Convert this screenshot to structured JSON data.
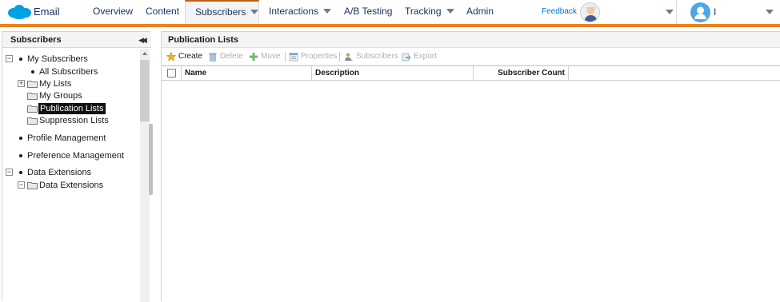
{
  "app": {
    "name": "Email"
  },
  "nav": {
    "items": [
      {
        "label": "Overview"
      },
      {
        "label": "Content"
      },
      {
        "label": "Subscribers"
      },
      {
        "label": "Interactions"
      },
      {
        "label": "A/B Testing"
      },
      {
        "label": "Tracking"
      },
      {
        "label": "Admin"
      }
    ],
    "active": "Subscribers",
    "feedback": "Feedback",
    "user_name": "I"
  },
  "left_panel": {
    "title": "Subscribers",
    "tree": [
      {
        "label": "My Subscribers"
      },
      {
        "label": "All Subscribers"
      },
      {
        "label": "My Lists"
      },
      {
        "label": "My Groups"
      },
      {
        "label": "Publication Lists"
      },
      {
        "label": "Suppression Lists"
      },
      {
        "label": "Profile Management"
      },
      {
        "label": "Preference Management"
      },
      {
        "label": "Data Extensions"
      },
      {
        "label": "Data Extensions"
      }
    ],
    "selected": "Publication Lists"
  },
  "main": {
    "title": "Publication Lists",
    "toolbar": [
      {
        "label": "Create",
        "icon": "create-star-icon",
        "enabled": true
      },
      {
        "label": "Delete",
        "icon": "trash-icon",
        "enabled": false
      },
      {
        "label": "Move",
        "icon": "move-plus-icon",
        "enabled": false
      },
      {
        "label": "Properties",
        "icon": "properties-icon",
        "enabled": false
      },
      {
        "label": "Subscribers",
        "icon": "subscribers-icon",
        "enabled": false
      },
      {
        "label": "Export",
        "icon": "export-icon",
        "enabled": false
      }
    ],
    "columns": [
      "Name",
      "Description",
      "Subscriber Count"
    ],
    "rows": []
  },
  "colors": {
    "accent_orange": "#e8831f",
    "link_blue": "#0070d2",
    "nav_text": "#16325c",
    "salesforce_blue": "#00a1e0"
  }
}
